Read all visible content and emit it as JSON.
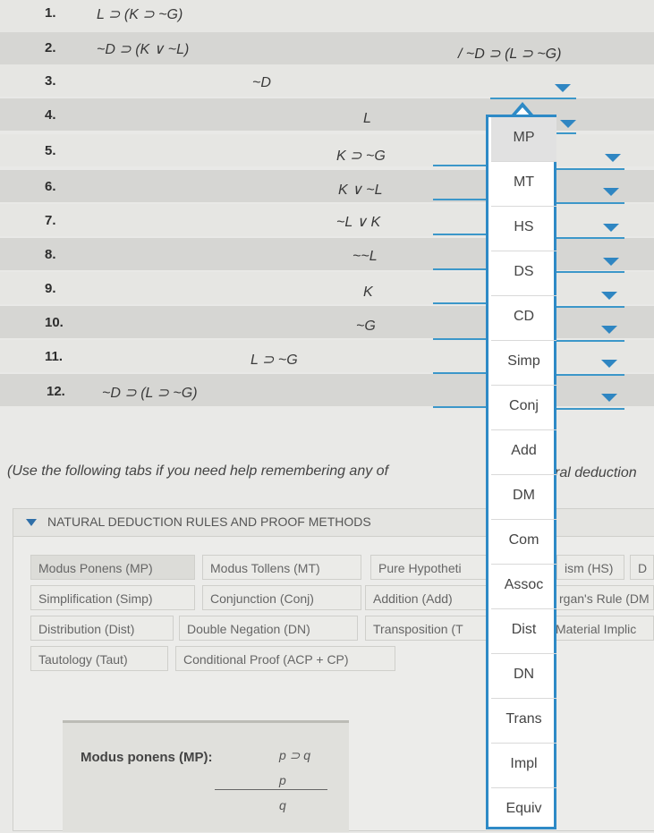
{
  "proof": {
    "lines": [
      {
        "num": "1.",
        "text": "L ⊃ (K ⊃ ~G)"
      },
      {
        "num": "2.",
        "text": "~D ⊃ (K ∨ ~L)"
      },
      {
        "num": "3.",
        "text": "~D"
      },
      {
        "num": "4.",
        "text": "L"
      },
      {
        "num": "5.",
        "text": "K ⊃ ~G"
      },
      {
        "num": "6.",
        "text": "K ∨ ~L"
      },
      {
        "num": "7.",
        "text": "~L ∨ K"
      },
      {
        "num": "8.",
        "text": "~~L"
      },
      {
        "num": "9.",
        "text": "K"
      },
      {
        "num": "10.",
        "text": "~G"
      },
      {
        "num": "11.",
        "text": "L ⊃ ~G"
      },
      {
        "num": "12.",
        "text": "~D ⊃ (L ⊃ ~G)"
      }
    ],
    "conclusion": "/ ~D ⊃ (L ⊃ ~G)"
  },
  "dropdown": {
    "options": [
      "MP",
      "MT",
      "HS",
      "DS",
      "CD",
      "Simp",
      "Conj",
      "Add",
      "DM",
      "Com",
      "Assoc",
      "Dist",
      "DN",
      "Trans",
      "Impl",
      "Equiv"
    ]
  },
  "hint": {
    "text": "(Use the following tabs if you need help remembering any of",
    "tail": "ral deduction"
  },
  "panel": {
    "title": "NATURAL DEDUCTION RULES AND PROOF METHODS",
    "tabs": {
      "mp": "Modus Ponens (MP)",
      "mt": "Modus Tollens (MT)",
      "hs_start": "Pure Hypotheti",
      "hs_end": "ism (HS)",
      "d": "D",
      "simp": "Simplification (Simp)",
      "conj": "Conjunction (Conj)",
      "add": "Addition (Add)",
      "dm": "rgan's Rule (DM",
      "dist": "Distribution (Dist)",
      "dn": "Double Negation (DN)",
      "trans": "Transposition (T",
      "impl": "Material Implic",
      "taut": "Tautology (Taut)",
      "cp": "Conditional Proof (ACP + CP)"
    }
  },
  "rule": {
    "name": "Modus ponens (MP):",
    "premise1": "p ⊃ q",
    "premise2": "p",
    "result": "q"
  },
  "colors": {
    "accent": "#2e8ac6",
    "row_shade": "#d6d6d3"
  }
}
